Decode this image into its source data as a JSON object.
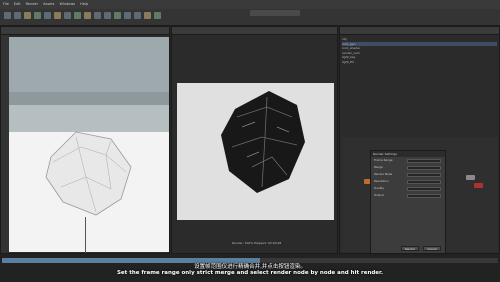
{
  "menu": [
    "File",
    "Edit",
    "Render",
    "Assets",
    "Windows",
    "Help"
  ],
  "dialog": {
    "title": "Render Settings",
    "rows": [
      {
        "label": "Frame Range",
        "value": "Strict"
      },
      {
        "label": "Merge",
        "value": "Strict Merge"
      },
      {
        "label": "Render Node",
        "value": "By Node"
      },
      {
        "label": "Resolution",
        "value": "Full"
      },
      {
        "label": "Quality",
        "value": "Medium"
      },
      {
        "label": "Output",
        "value": "Render"
      }
    ],
    "ok_label": "Render",
    "cancel_label": "Cancel"
  },
  "tree_items": [
    "obj",
    "rock_geo",
    "rock_shader",
    "render_cam",
    "light_key",
    "light_fill"
  ],
  "render_status": "Render: 100%  Elapsed: 00:00:28",
  "timeline_progress": 0.52,
  "subtitle_cn": "设置帧范围仅进行精确合并,并点击按钮渲染。",
  "subtitle_en": "Set the frame range only strict merge and select render node by node and hit render."
}
